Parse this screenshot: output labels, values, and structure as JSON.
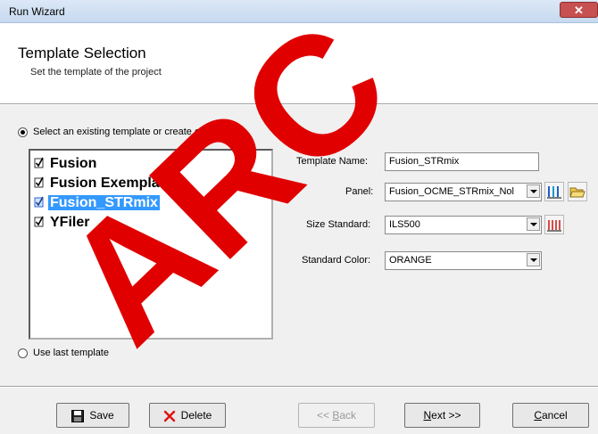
{
  "window": {
    "title": "Run Wizard",
    "close_glyph": "✕"
  },
  "header": {
    "title": "Template Selection",
    "subtitle": "Set the template of the project"
  },
  "options": {
    "existing_label": "Select an existing template or create one",
    "existing_selected": true,
    "last_label": "Use last template",
    "last_selected": false
  },
  "templates": [
    {
      "label": "Fusion",
      "checked": true,
      "selected": false
    },
    {
      "label": "Fusion Exemplars",
      "checked": true,
      "selected": false
    },
    {
      "label": "Fusion_STRmix",
      "checked": true,
      "selected": true
    },
    {
      "label": "YFiler",
      "checked": true,
      "selected": false
    }
  ],
  "form": {
    "template_name_label": "Template Name:",
    "template_name_value": "Fusion_STRmix",
    "panel_label": "Panel:",
    "panel_value": "Fusion_OCME_STRmix_Nol",
    "size_standard_label": "Size Standard:",
    "size_standard_value": "ILS500",
    "standard_color_label": "Standard Color:",
    "standard_color_value": "ORANGE"
  },
  "buttons": {
    "save": "Save",
    "delete": "Delete",
    "back": "<< Back",
    "next": "Next >>",
    "cancel": "Cancel"
  },
  "watermark": {
    "text": "ARC"
  },
  "colors": {
    "selection": "#3399ff",
    "close": "#c75050",
    "watermark": "#e00000"
  },
  "icons": [
    "close-icon",
    "checked-box-icon",
    "panel-graph-icon",
    "open-folder-icon",
    "size-standard-graph-icon",
    "save-disk-icon",
    "delete-x-icon"
  ]
}
